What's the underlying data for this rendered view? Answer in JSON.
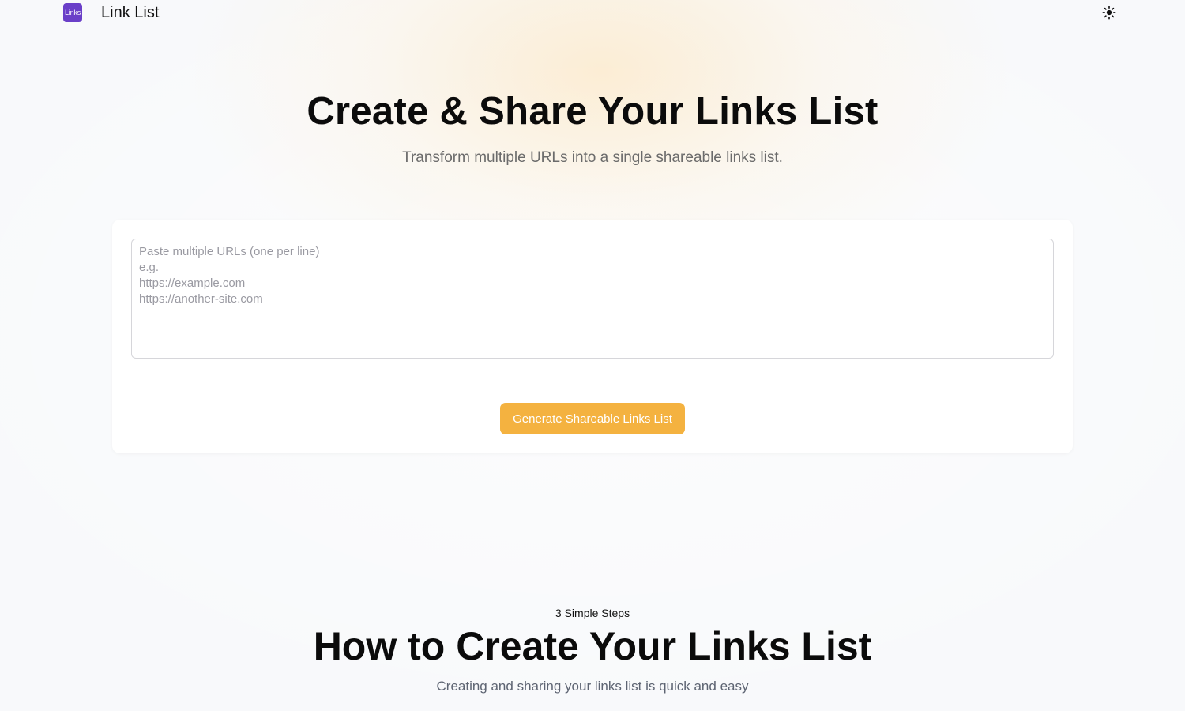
{
  "header": {
    "logo_text": "Links",
    "app_title": "Link List",
    "theme_toggle_icon": "sun-icon"
  },
  "hero": {
    "title": "Create & Share Your Links List",
    "subtitle": "Transform multiple URLs into a single shareable links list."
  },
  "form": {
    "url_input_value": "",
    "url_input_placeholder": "Paste multiple URLs (one per line)\ne.g.\nhttps://example.com\nhttps://another-site.com",
    "generate_label": "Generate Shareable Links List"
  },
  "steps": {
    "eyebrow": "3 Simple Steps",
    "title": "How to Create Your Links List",
    "subtitle": "Creating and sharing your links list is quick and easy"
  },
  "colors": {
    "brand": "#6a3fc8",
    "accent": "#f4b240",
    "page_background": "#f8f9fb"
  }
}
